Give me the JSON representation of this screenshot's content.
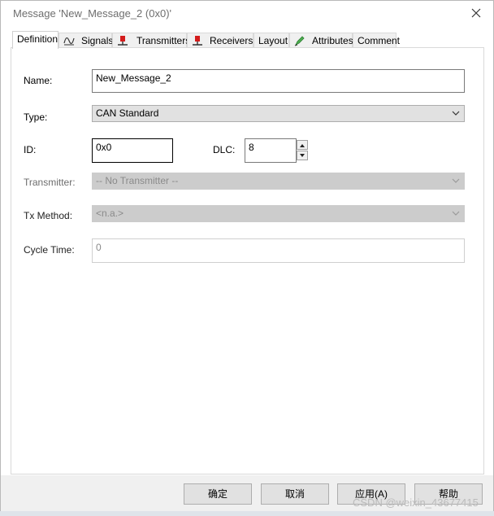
{
  "window": {
    "title": "Message 'New_Message_2 (0x0)'"
  },
  "tabs": [
    {
      "label": "Definition",
      "icon": "none",
      "active": true
    },
    {
      "label": "Signals",
      "icon": "signal-wave-icon"
    },
    {
      "label": "Transmitters",
      "icon": "transmitter-node-icon"
    },
    {
      "label": "Receivers",
      "icon": "receiver-node-icon"
    },
    {
      "label": "Layout",
      "icon": "none"
    },
    {
      "label": "Attributes",
      "icon": "pencil-icon"
    },
    {
      "label": "Comment",
      "icon": "none"
    }
  ],
  "form": {
    "name_label": "Name:",
    "name_value": "New_Message_2",
    "type_label": "Type:",
    "type_value": "CAN Standard",
    "id_label": "ID:",
    "id_value": "0x0",
    "dlc_label": "DLC:",
    "dlc_value": "8",
    "transmitter_label": "Transmitter:",
    "transmitter_value": "-- No Transmitter --",
    "tx_method_label": "Tx Method:",
    "tx_method_value": "<n.a.>",
    "cycle_time_label": "Cycle Time:",
    "cycle_time_value": "0"
  },
  "buttons": {
    "ok": "确定",
    "cancel": "取消",
    "apply": "应用(A)",
    "help": "帮助"
  },
  "watermark": "CSDN @weixin_43677415",
  "colors": {
    "node_icon_red": "#d41c1c",
    "tab_border": "#d9d9d9",
    "disabled_gray": "#cccccc"
  }
}
